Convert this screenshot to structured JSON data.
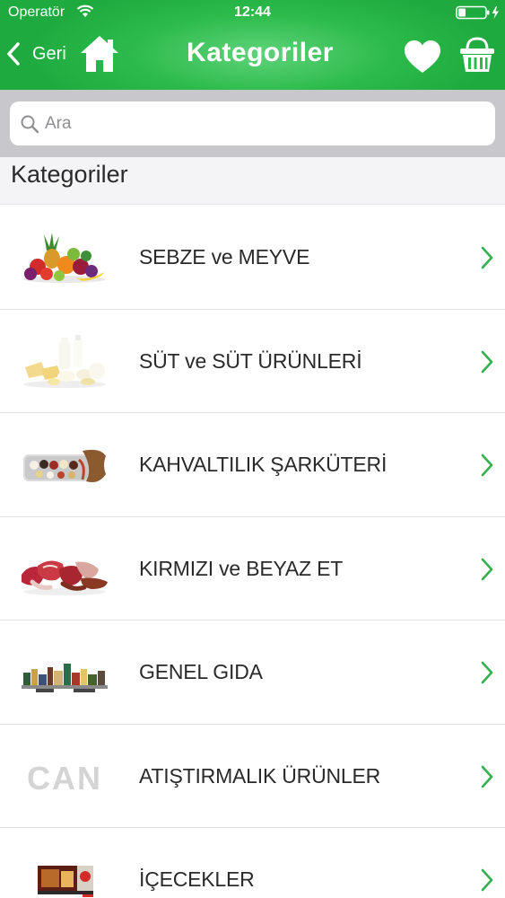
{
  "status_bar": {
    "carrier": "Operatör",
    "time": "12:44"
  },
  "nav": {
    "back_label": "Geri",
    "title": "Kategoriler"
  },
  "search": {
    "placeholder": "Ara",
    "value": ""
  },
  "section": {
    "header": "Kategoriler"
  },
  "categories": [
    {
      "label": "SEBZE ve MEYVE",
      "thumb": "fruits-vegetables-image"
    },
    {
      "label": "SÜT ve SÜT ÜRÜNLERİ",
      "thumb": "dairy-products-image"
    },
    {
      "label": "KAHVALTILIK ŞARKÜTERİ",
      "thumb": "breakfast-deli-image"
    },
    {
      "label": "KIRMIZI ve BEYAZ ET",
      "thumb": "meat-image"
    },
    {
      "label": "GENEL GIDA",
      "thumb": "grocery-shelf-image"
    },
    {
      "label": "ATIŞTIRMALIK ÜRÜNLER",
      "thumb": "can-logo"
    },
    {
      "label": "İÇECEKLER",
      "thumb": "beverages-image"
    }
  ],
  "thumb_logo_text": "CAN",
  "colors": {
    "nav_green": "#2cbb4b",
    "chevron_green": "#34b04f",
    "search_bar_gray": "#c7c7cc"
  }
}
